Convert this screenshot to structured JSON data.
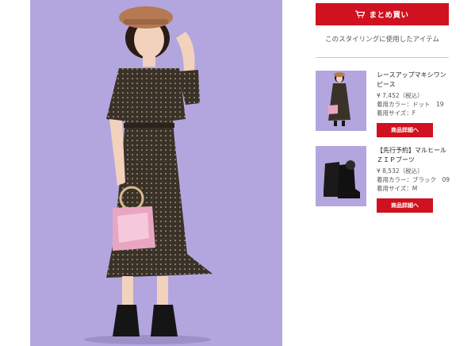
{
  "cart": {
    "label": "まとめ買い",
    "icon": "cart-icon"
  },
  "section": {
    "title": "このスタイリングに使用したアイテム"
  },
  "items": [
    {
      "name": "レースアップマキシワンピース",
      "price": "¥ 7,452（税込）",
      "color": "着用カラー：ドット　19",
      "size": "着用サイズ：F",
      "button": "商品詳細へ"
    },
    {
      "name": "【先行予約】マルヒールＺＩＰブーツ",
      "price": "¥ 8,532（税込）",
      "color": "着用カラー：ブラック　09",
      "size": "着用サイズ：M",
      "button": "商品詳細へ"
    }
  ],
  "colors": {
    "accent": "#d0111f",
    "photo_bg": "#b3a6df"
  }
}
